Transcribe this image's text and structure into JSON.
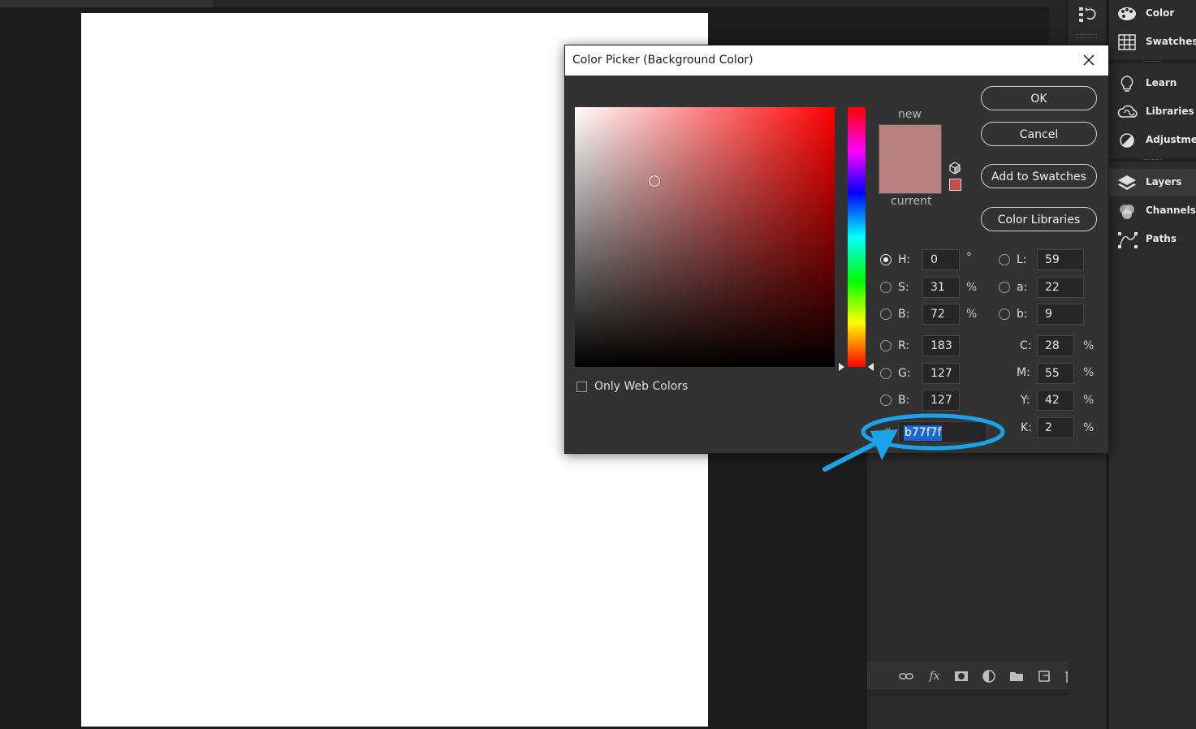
{
  "dialog": {
    "title": "Color Picker (Background Color)",
    "new_label": "new",
    "current_label": "current",
    "new_color": "#b77f7f",
    "current_color": "#b77f7f",
    "websafe_color": "#c84a4a",
    "buttons": {
      "ok": "OK",
      "cancel": "Cancel",
      "add_to_swatches": "Add to Swatches",
      "color_libraries": "Color Libraries"
    },
    "only_web_colors": "Only Web Colors",
    "hsb": {
      "h": {
        "label": "H:",
        "value": "0",
        "unit": "°"
      },
      "s": {
        "label": "S:",
        "value": "31",
        "unit": "%"
      },
      "b": {
        "label": "B:",
        "value": "72",
        "unit": "%"
      }
    },
    "rgb": {
      "r": {
        "label": "R:",
        "value": "183"
      },
      "g": {
        "label": "G:",
        "value": "127"
      },
      "b": {
        "label": "B:",
        "value": "127"
      }
    },
    "lab": {
      "l": {
        "label": "L:",
        "value": "59"
      },
      "a": {
        "label": "a:",
        "value": "22"
      },
      "b": {
        "label": "b:",
        "value": "9"
      }
    },
    "cmyk": {
      "c": {
        "label": "C:",
        "value": "28",
        "unit": "%"
      },
      "m": {
        "label": "M:",
        "value": "55",
        "unit": "%"
      },
      "y": {
        "label": "Y:",
        "value": "42",
        "unit": "%"
      },
      "k": {
        "label": "K:",
        "value": "2",
        "unit": "%"
      }
    },
    "hex": {
      "hash": "#",
      "value": "b77f7f"
    }
  },
  "panels": {
    "items": [
      {
        "label": "Color",
        "icon": "palette-icon"
      },
      {
        "label": "Swatches",
        "icon": "swatches-grid-icon"
      },
      {
        "label": "Learn",
        "icon": "lightbulb-icon"
      },
      {
        "label": "Libraries",
        "icon": "cc-libraries-icon"
      },
      {
        "label": "Adjustments",
        "icon": "adjustments-icon"
      },
      {
        "label": "Layers",
        "icon": "layers-icon"
      },
      {
        "label": "Channels",
        "icon": "channels-icon"
      },
      {
        "label": "Paths",
        "icon": "paths-icon"
      }
    ]
  },
  "layers_footer": {
    "fx": "fx"
  },
  "colors": {
    "annotation": "#1aa3e8",
    "selection": "#1a66cc"
  }
}
